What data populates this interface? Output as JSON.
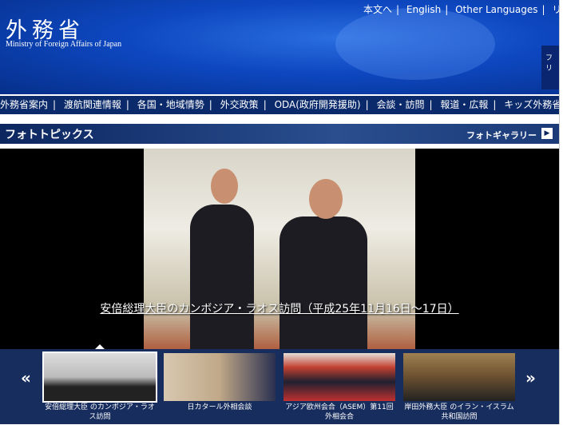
{
  "header": {
    "logo": "外務省",
    "logo_en": "Ministry of Foreign Affairs of Japan",
    "top_links": [
      "本文へ",
      "English",
      "Other Languages",
      "リン"
    ],
    "side_tab": "フリ"
  },
  "nav": [
    "外務省案内",
    "渡航関連情報",
    "各国・地域情勢",
    "外交政策",
    "ODA(政府開発援助)",
    "会談・訪問",
    "報道・広報",
    "キッズ外務省"
  ],
  "section": {
    "title": "フォトトピックス",
    "gallery_link": "フォトギャラリー"
  },
  "feature": {
    "caption": "安倍総理大臣のカンボジア・ラオス訪問（平成25年11月16日～17日）"
  },
  "thumbnails": [
    {
      "caption": "安倍総理大臣 のカンボジア・ラオス訪問",
      "selected": true
    },
    {
      "caption": "日カタール外相会談",
      "selected": false
    },
    {
      "caption": "アジア欧州会合（ASEM）第11回外相会合",
      "selected": false
    },
    {
      "caption": "岸田外務大臣 のイラン・イスラム共和国訪問",
      "selected": false
    }
  ],
  "strip": {
    "prev": "«",
    "next": "»"
  },
  "colors": {
    "nav_bg": "#0b2a6b",
    "strip_bg": "#172d5e",
    "header_blue": "#0d47c0"
  }
}
